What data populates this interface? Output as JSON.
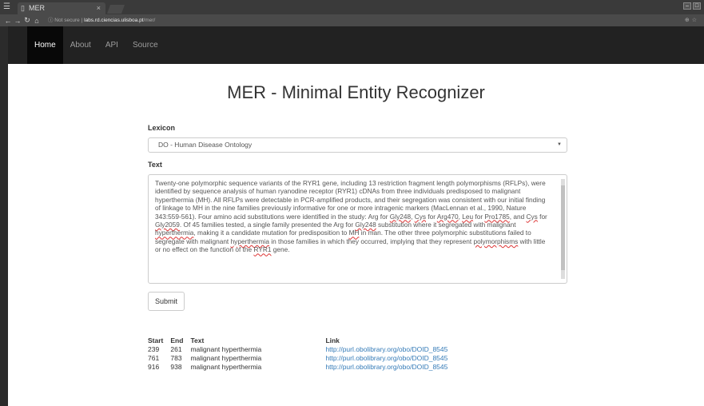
{
  "browser": {
    "tab_title": "MER",
    "tab_close": "×",
    "not_secure": "ⓘ Not secure",
    "url_host": "labs.rd.ciencias.ulisboa.pt",
    "url_path": "/mer/"
  },
  "nav": {
    "items": [
      "Home",
      "About",
      "API",
      "Source"
    ]
  },
  "page_title": "MER - Minimal Entity Recognizer",
  "lexicon": {
    "label": "Lexicon",
    "selected": "DO - Human Disease Ontology"
  },
  "text": {
    "label": "Text",
    "value_parts": [
      "Twenty-one polymorphic sequence variants of the RYR1 gene, including 13 restriction fragment length polymorphisms (RFLPs), were identified by sequence analysis of human ryanodine receptor (RYR1) cDNAs from three individuals predisposed to malignant hyperthermia (MH). All RFLPs were detectable in PCR-amplified products, and their segregation was consistent with our initial finding of linkage to MH in the nine families previously informative for one or more intragenic markers (MacLennan et al., 1990, Nature 343:559-561). Four amino acid substitutions were identified in the study: Arg for ",
      "Gly248",
      ", ",
      "Cys",
      " for ",
      "Arg470",
      ", ",
      "Leu",
      " for ",
      "Pro1785",
      ", and ",
      "Cys",
      " for ",
      "Gly2059",
      ". Of 45 families tested, a single family presented the Arg for ",
      "Gly248",
      " substitution where it segregated with malignant ",
      "hyperthermia",
      ", making it a candidate mutation for predisposition to ",
      "MH",
      " in man. The other three polymorphic substitutions failed to segregate with malignant ",
      "hyperthermia",
      " in those families in which they occurred, implying that they represent ",
      "polymorphisms",
      " with little or no effect on the function of the ",
      "RYR1",
      " gene."
    ]
  },
  "submit_label": "Submit",
  "results": {
    "headers": [
      "Start",
      "End",
      "Text",
      "Link"
    ],
    "rows": [
      [
        "239",
        "261",
        "malignant hyperthermia",
        "http://purl.obolibrary.org/obo/DOID_8545"
      ],
      [
        "761",
        "783",
        "malignant hyperthermia",
        "http://purl.obolibrary.org/obo/DOID_8545"
      ],
      [
        "916",
        "938",
        "malignant hyperthermia",
        "http://purl.obolibrary.org/obo/DOID_8545"
      ]
    ]
  }
}
